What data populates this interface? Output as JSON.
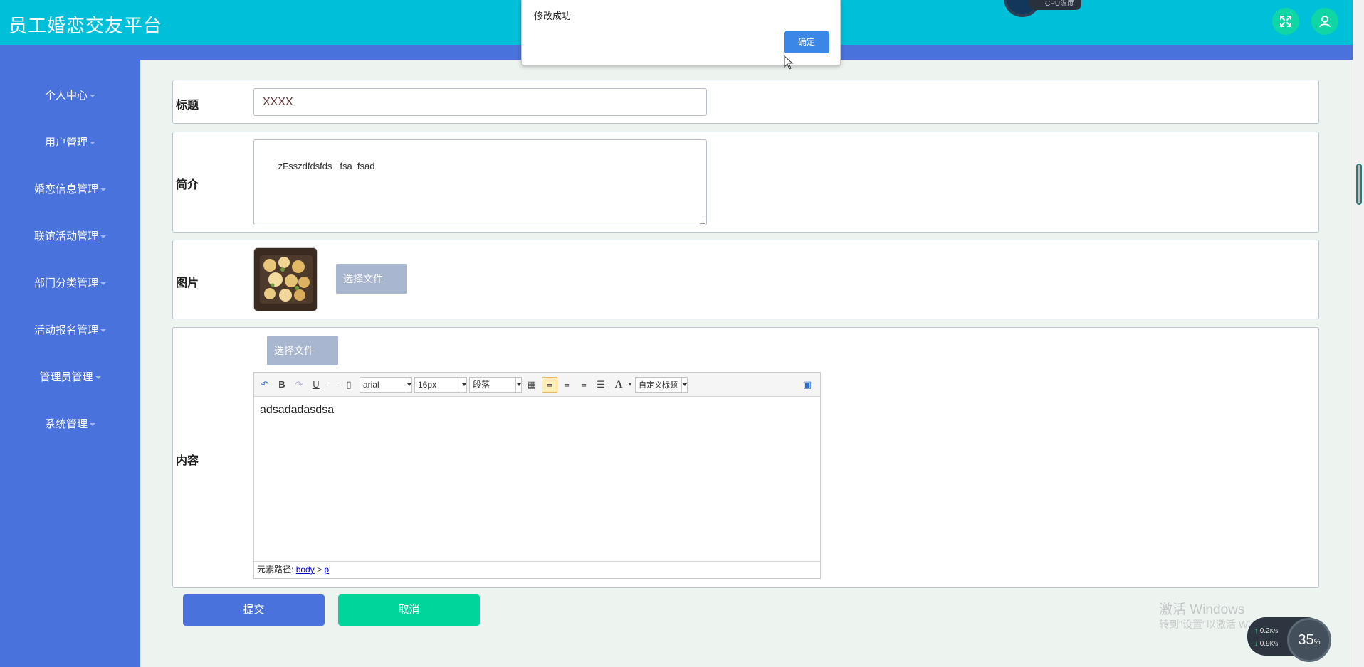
{
  "app_title": "员工婚恋交友平台",
  "cpu_label": "CPU温度",
  "sidebar": {
    "items": [
      {
        "label": "个人中心"
      },
      {
        "label": "用户管理"
      },
      {
        "label": "婚恋信息管理"
      },
      {
        "label": "联谊活动管理"
      },
      {
        "label": "部门分类管理"
      },
      {
        "label": "活动报名管理"
      },
      {
        "label": "管理员管理"
      },
      {
        "label": "系统管理"
      }
    ]
  },
  "form": {
    "title_label": "标题",
    "title_value": "XXXX",
    "intro_label": "简介",
    "intro_value": "zFsszdfdsfds   fsa  fsad",
    "image_label": "图片",
    "image_button": "选择文件",
    "content_label": "内容",
    "content_file_button": "选择文件",
    "editor": {
      "font_family": "arial",
      "font_size": "16px",
      "paragraph": "段落",
      "custom_heading": "自定义标题",
      "body_text": "adsadadasdsa",
      "path_label": "元素路径:",
      "path_body": "body",
      "path_sep": ">",
      "path_p": "p"
    },
    "submit_label": "提交",
    "cancel_label": "取消"
  },
  "dialog": {
    "message": "修改成功",
    "ok_label": "确定"
  },
  "watermark": {
    "line1": "激活 Windows",
    "line2": "转到\"设置\"以激活 Windows。"
  },
  "net_widget": {
    "up": "0.2",
    "down": "0.9",
    "unit": "K/s",
    "percent": "35",
    "percent_sign": "%"
  },
  "colors": {
    "header": "#00c0d9",
    "sidebar": "#4a72dd",
    "submit": "#4a72dd",
    "cancel": "#00d69b",
    "dialog_ok": "#3b87e7"
  }
}
